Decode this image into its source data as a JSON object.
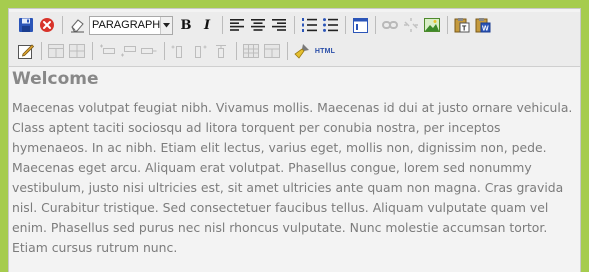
{
  "toolbar": {
    "format_select": {
      "selected": "PARAGRAPHE"
    },
    "bold_label": "B",
    "italic_label": "I",
    "html_label": "HTML"
  },
  "content": {
    "heading": "Welcome",
    "paragraph": "Maecenas volutpat feugiat nibh. Vivamus mollis. Maecenas id dui at justo ornare vehicula. Class aptent taciti sociosqu ad litora torquent per conubia nostra, per inceptos hymenaeos. In ac nibh. Etiam elit lectus, varius eget, mollis non, dignissim non, pede. Maecenas eget arcu. Aliquam erat volutpat. Phasellus congue, lorem sed nonummy vestibulum, justo nisi ultricies est, sit amet ultricies ante quam non magna. Cras gravida nisl. Curabitur tristique. Sed consectetuer faucibus tellus. Aliquam vulputate quam vel enim. Phasellus sed purus nec nisl rhoncus vulputate. Nunc molestie accumsan tortor. Etiam cursus rutrum nunc."
  },
  "colors": {
    "page_background": "#a6cc4e",
    "editor_background": "#f3f3f3",
    "text": "#7c7c7c"
  }
}
